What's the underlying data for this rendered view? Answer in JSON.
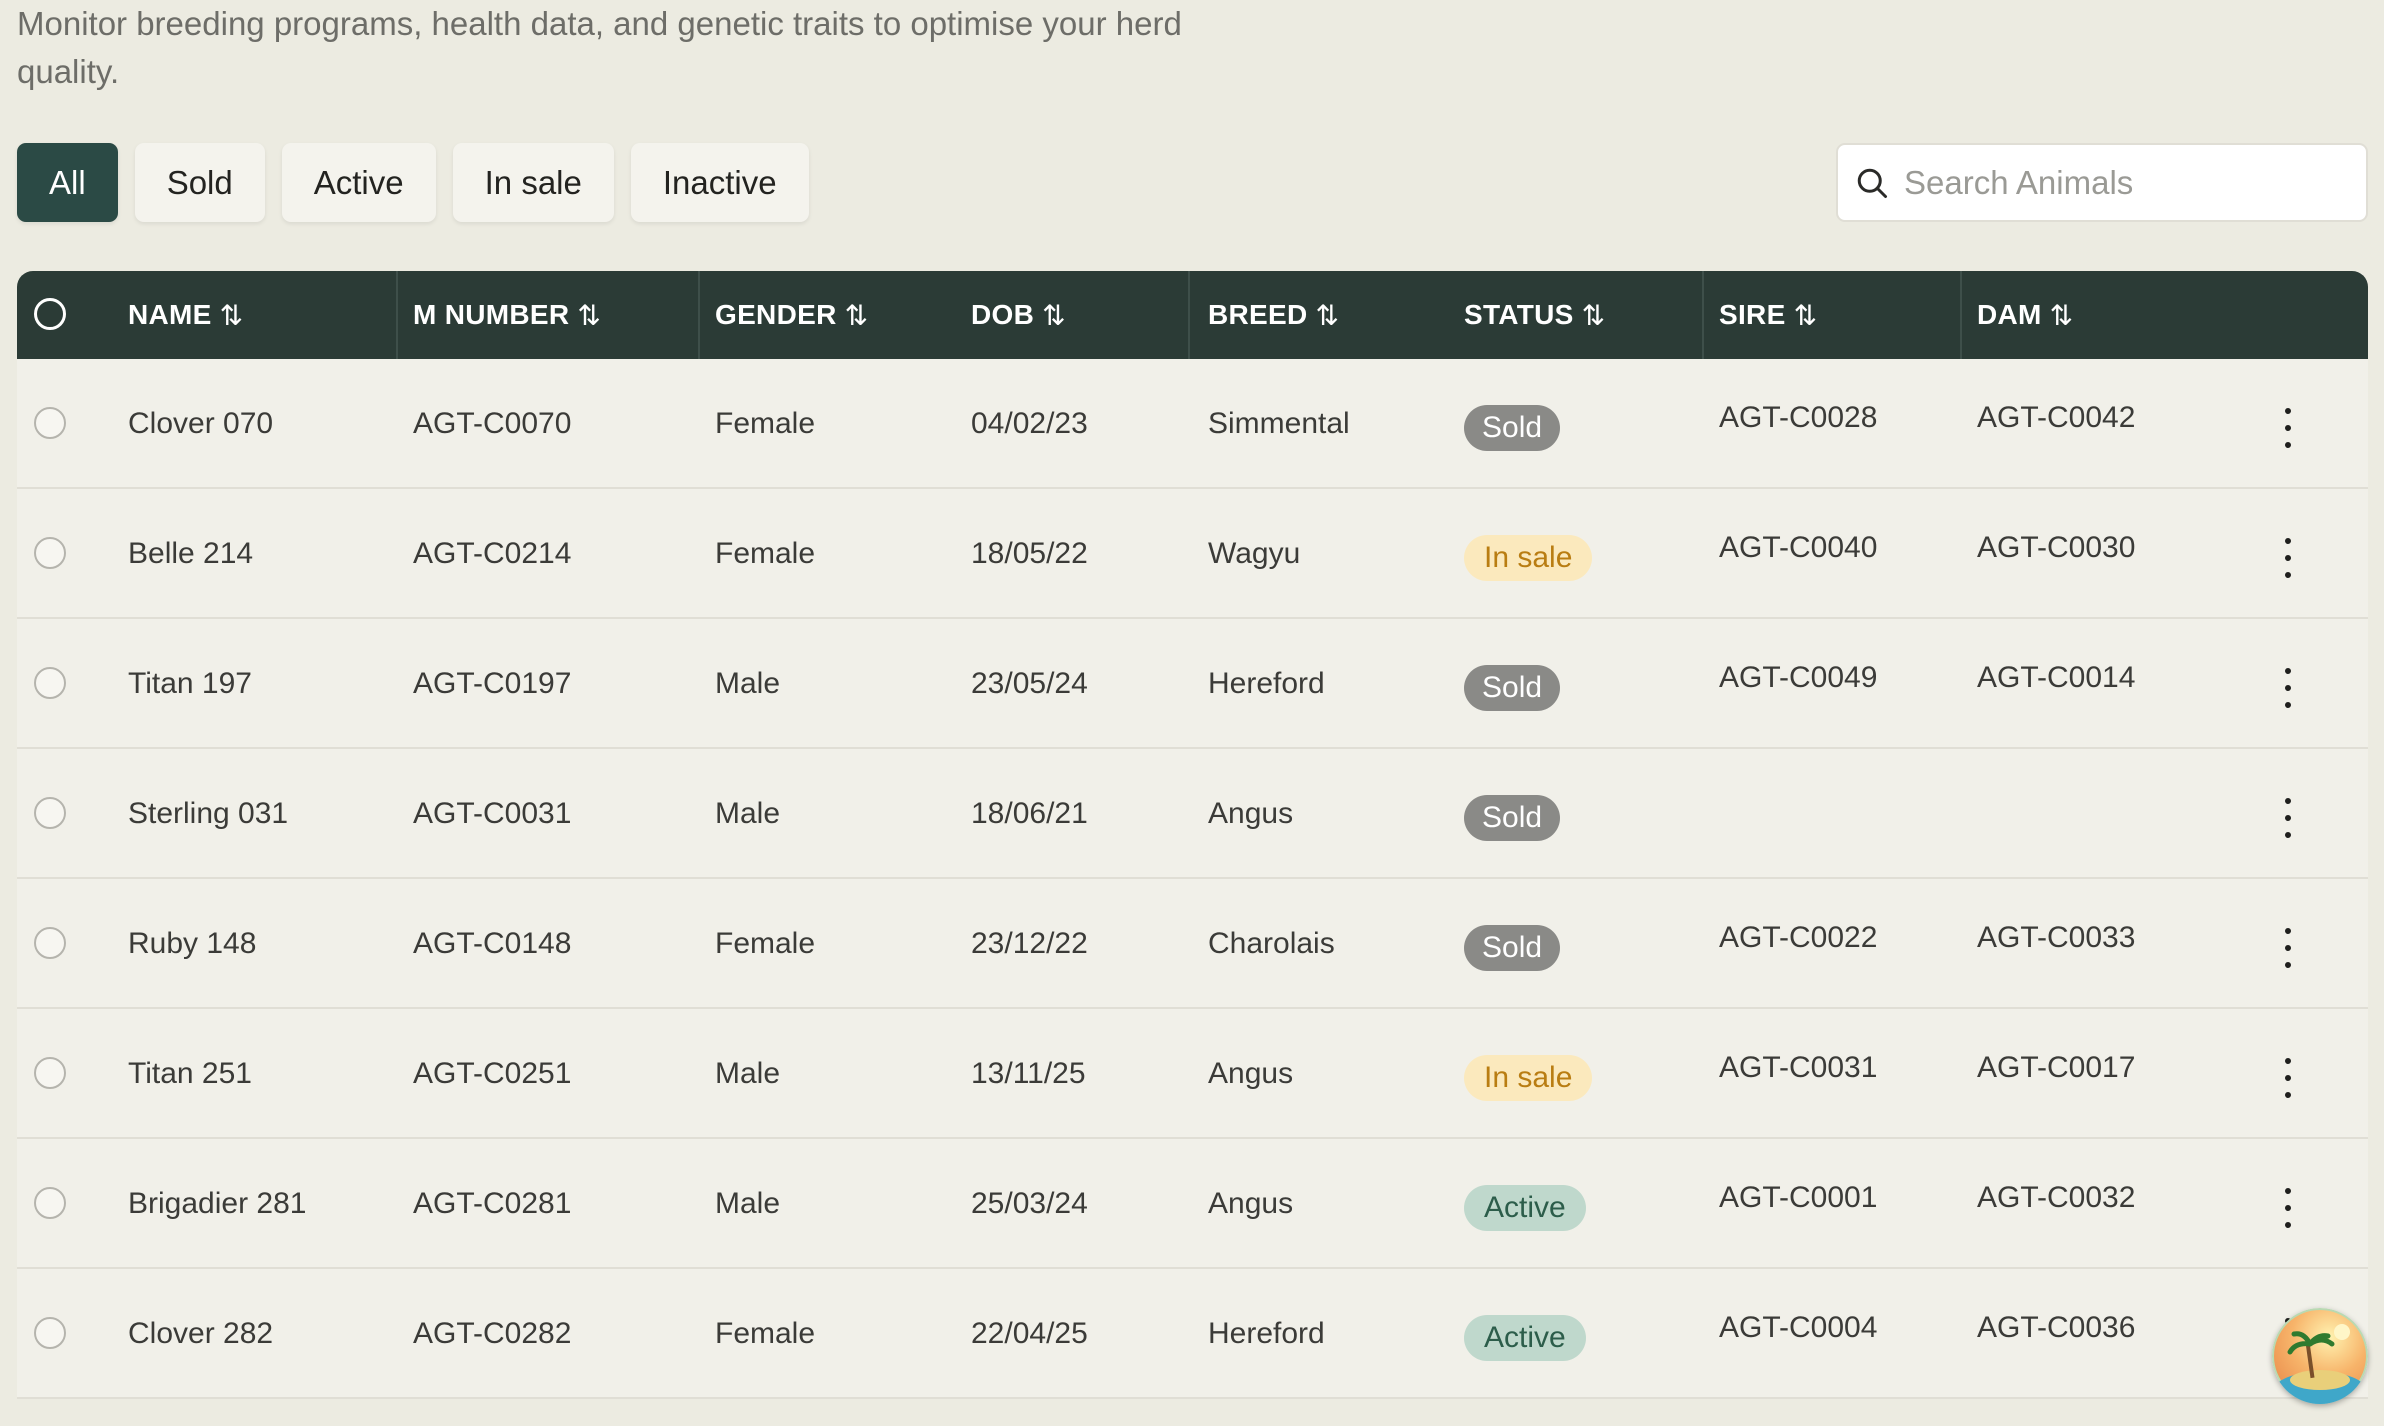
{
  "header": {
    "subtitle": "Monitor breeding programs, health data, and genetic traits to optimise your herd quality."
  },
  "filters": [
    {
      "label": "All",
      "active": true
    },
    {
      "label": "Sold",
      "active": false
    },
    {
      "label": "Active",
      "active": false
    },
    {
      "label": "In sale",
      "active": false
    },
    {
      "label": "Inactive",
      "active": false
    }
  ],
  "search": {
    "placeholder": "Search Animals",
    "icon": "search-icon"
  },
  "table": {
    "columns": [
      "NAME",
      "M NUMBER",
      "GENDER",
      "DOB",
      "BREED",
      "STATUS",
      "SIRE",
      "DAM"
    ],
    "sort_icon": "⇅",
    "rows": [
      {
        "name": "Clover 070",
        "mnumber": "AGT-C0070",
        "gender": "Female",
        "dob": "04/02/23",
        "breed": "Simmental",
        "status": "Sold",
        "sire": "AGT-C0028",
        "dam": "AGT-C0042"
      },
      {
        "name": "Belle 214",
        "mnumber": "AGT-C0214",
        "gender": "Female",
        "dob": "18/05/22",
        "breed": "Wagyu",
        "status": "In sale",
        "sire": "AGT-C0040",
        "dam": "AGT-C0030"
      },
      {
        "name": "Titan 197",
        "mnumber": "AGT-C0197",
        "gender": "Male",
        "dob": "23/05/24",
        "breed": "Hereford",
        "status": "Sold",
        "sire": "AGT-C0049",
        "dam": "AGT-C0014"
      },
      {
        "name": "Sterling 031",
        "mnumber": "AGT-C0031",
        "gender": "Male",
        "dob": "18/06/21",
        "breed": "Angus",
        "status": "Sold",
        "sire": "",
        "dam": ""
      },
      {
        "name": "Ruby 148",
        "mnumber": "AGT-C0148",
        "gender": "Female",
        "dob": "23/12/22",
        "breed": "Charolais",
        "status": "Sold",
        "sire": "AGT-C0022",
        "dam": "AGT-C0033"
      },
      {
        "name": "Titan 251",
        "mnumber": "AGT-C0251",
        "gender": "Male",
        "dob": "13/11/25",
        "breed": "Angus",
        "status": "In sale",
        "sire": "AGT-C0031",
        "dam": "AGT-C0017"
      },
      {
        "name": "Brigadier 281",
        "mnumber": "AGT-C0281",
        "gender": "Male",
        "dob": "25/03/24",
        "breed": "Angus",
        "status": "Active",
        "sire": "AGT-C0001",
        "dam": "AGT-C0032"
      },
      {
        "name": "Clover 282",
        "mnumber": "AGT-C0282",
        "gender": "Female",
        "dob": "22/04/25",
        "breed": "Hereford",
        "status": "Active",
        "sire": "AGT-C0004",
        "dam": "AGT-C0036"
      }
    ]
  },
  "colors": {
    "page_bg": "#ecebe1",
    "header_bg": "#2b3b36",
    "primary": "#2b4a45",
    "sold_badge": "#8a8a87",
    "insale_badge": "#fbe9bd",
    "active_badge": "#bfd8cc"
  },
  "user": {
    "avatar_icon": "island-avatar-icon"
  }
}
